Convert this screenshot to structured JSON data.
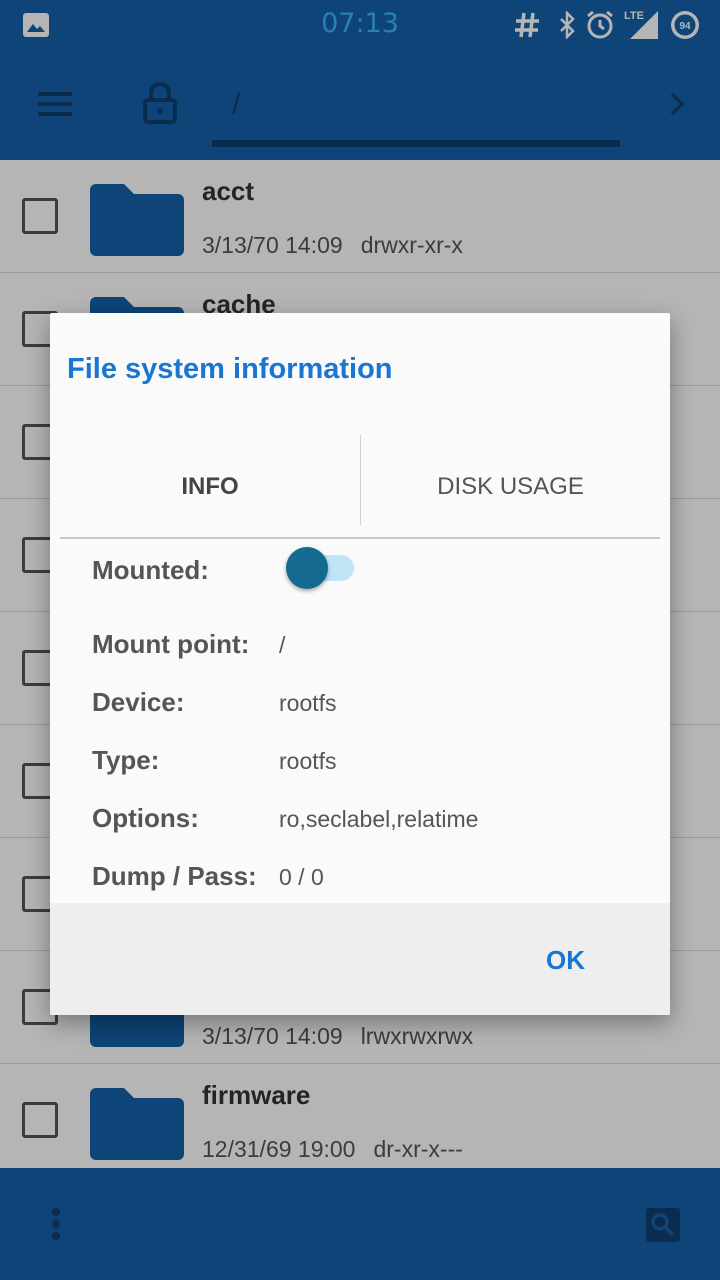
{
  "status_bar": {
    "time": "07:13",
    "icons": [
      "image-notification-icon",
      "hash-icon",
      "bluetooth-icon",
      "alarm-icon",
      "lte-signal-icon",
      "battery-icon"
    ],
    "network_label": "LTE",
    "battery_level": "94"
  },
  "toolbar": {
    "path": "/"
  },
  "file_list": [
    {
      "name": "acct",
      "date": "3/13/70 14:09",
      "perms": "drwxr-xr-x"
    },
    {
      "name": "cache",
      "date": "",
      "perms": ""
    },
    {
      "name": "",
      "date": "",
      "perms": ""
    },
    {
      "name": "",
      "date": "",
      "perms": ""
    },
    {
      "name": "",
      "date": "",
      "perms": ""
    },
    {
      "name": "",
      "date": "",
      "perms": ""
    },
    {
      "name": "",
      "date": "",
      "perms": ""
    },
    {
      "name": "",
      "date": "3/13/70 14:09",
      "perms": "lrwxrwxrwx"
    },
    {
      "name": "firmware",
      "date": "12/31/69 19:00",
      "perms": "dr-xr-x---"
    }
  ],
  "dialog": {
    "title": "File system information",
    "tabs": [
      {
        "label": "INFO",
        "selected": true
      },
      {
        "label": "DISK USAGE",
        "selected": false
      }
    ],
    "mounted_label": "Mounted:",
    "mounted_value": true,
    "fields": [
      {
        "label": "Mount point:",
        "value": "/"
      },
      {
        "label": "Device:",
        "value": "rootfs"
      },
      {
        "label": "Type:",
        "value": "rootfs"
      },
      {
        "label": "Options:",
        "value": "ro,seclabel,relatime"
      },
      {
        "label": "Dump / Pass:",
        "value": "0 / 0"
      }
    ],
    "ok_label": "OK"
  },
  "colors": {
    "primary": "#1561a8",
    "primary_dark_icon": "#0e3f70",
    "accent": "#1976d2",
    "time_color": "#3fb3ff",
    "toggle_thumb": "#156b8f",
    "toggle_track": "#bfe4f5"
  }
}
